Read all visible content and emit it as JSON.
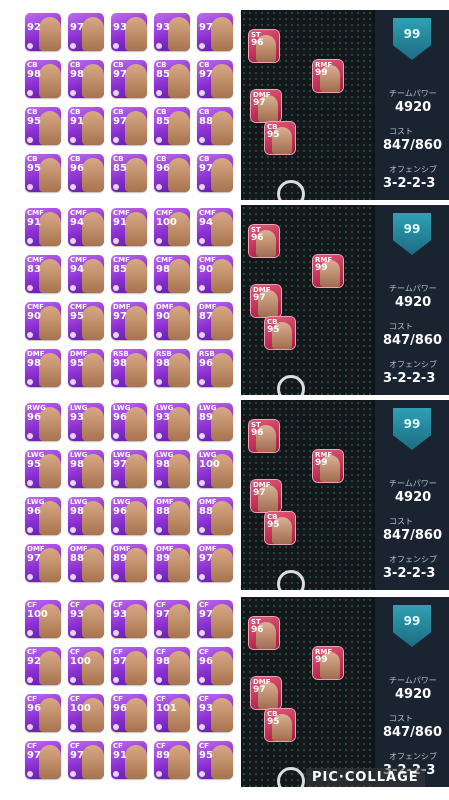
{
  "panels": [
    {
      "cards": [
        [
          {
            "pos": "",
            "ovr": "92"
          },
          {
            "pos": "",
            "ovr": "97"
          },
          {
            "pos": "",
            "ovr": "93"
          },
          {
            "pos": "",
            "ovr": "93"
          },
          {
            "pos": "",
            "ovr": "97"
          }
        ],
        [
          {
            "pos": "CB",
            "ovr": "98"
          },
          {
            "pos": "CB",
            "ovr": "98"
          },
          {
            "pos": "CB",
            "ovr": "97"
          },
          {
            "pos": "CB",
            "ovr": "85"
          },
          {
            "pos": "CB",
            "ovr": "97"
          }
        ],
        [
          {
            "pos": "CB",
            "ovr": "95"
          },
          {
            "pos": "CB",
            "ovr": "91"
          },
          {
            "pos": "CB",
            "ovr": "97"
          },
          {
            "pos": "CB",
            "ovr": "85"
          },
          {
            "pos": "CB",
            "ovr": "88"
          }
        ],
        [
          {
            "pos": "CB",
            "ovr": "95"
          },
          {
            "pos": "CB",
            "ovr": "96"
          },
          {
            "pos": "CB",
            "ovr": "85"
          },
          {
            "pos": "CB",
            "ovr": "96"
          },
          {
            "pos": "CB",
            "ovr": "97"
          }
        ]
      ],
      "pitch": [
        {
          "pos": "ST",
          "ovr": "96"
        },
        {
          "pos": "RMF",
          "ovr": "99"
        },
        {
          "pos": "DMF",
          "ovr": "97"
        },
        {
          "pos": "CB",
          "ovr": "95"
        }
      ],
      "stats": {
        "rating": "99",
        "power_label": "チームパワー",
        "power": "4920",
        "cost_label": "コスト",
        "cost": "847/860",
        "offense_label": "オフェンシブ",
        "formation": "3-2-2-3"
      }
    },
    {
      "cards": [
        [
          {
            "pos": "CMF",
            "ovr": "91"
          },
          {
            "pos": "CMF",
            "ovr": "94"
          },
          {
            "pos": "CMF",
            "ovr": "91"
          },
          {
            "pos": "CMF",
            "ovr": "100"
          },
          {
            "pos": "CMF",
            "ovr": "94"
          }
        ],
        [
          {
            "pos": "CMF",
            "ovr": "83"
          },
          {
            "pos": "CMF",
            "ovr": "94"
          },
          {
            "pos": "CMF",
            "ovr": "85"
          },
          {
            "pos": "CMF",
            "ovr": "98"
          },
          {
            "pos": "CMF",
            "ovr": "90"
          }
        ],
        [
          {
            "pos": "CMF",
            "ovr": "90"
          },
          {
            "pos": "CMF",
            "ovr": "95"
          },
          {
            "pos": "DMF",
            "ovr": "97"
          },
          {
            "pos": "DMF",
            "ovr": "90"
          },
          {
            "pos": "DMF",
            "ovr": "87"
          }
        ],
        [
          {
            "pos": "DMF",
            "ovr": "98"
          },
          {
            "pos": "DMF",
            "ovr": "95"
          },
          {
            "pos": "RSB",
            "ovr": "98"
          },
          {
            "pos": "RSB",
            "ovr": "98"
          },
          {
            "pos": "RSB",
            "ovr": "96"
          }
        ]
      ],
      "pitch": [
        {
          "pos": "ST",
          "ovr": "96"
        },
        {
          "pos": "RMF",
          "ovr": "99"
        },
        {
          "pos": "DMF",
          "ovr": "97"
        },
        {
          "pos": "CB",
          "ovr": "95"
        }
      ],
      "stats": {
        "rating": "99",
        "power_label": "チームパワー",
        "power": "4920",
        "cost_label": "コスト",
        "cost": "847/860",
        "offense_label": "オフェンシブ",
        "formation": "3-2-2-3"
      }
    },
    {
      "cards": [
        [
          {
            "pos": "RWG",
            "ovr": "96"
          },
          {
            "pos": "LWG",
            "ovr": "93"
          },
          {
            "pos": "LWG",
            "ovr": "96"
          },
          {
            "pos": "LWG",
            "ovr": "93"
          },
          {
            "pos": "LWG",
            "ovr": "89"
          }
        ],
        [
          {
            "pos": "LWG",
            "ovr": "95"
          },
          {
            "pos": "LWG",
            "ovr": "98"
          },
          {
            "pos": "LWG",
            "ovr": "97"
          },
          {
            "pos": "LWG",
            "ovr": "98"
          },
          {
            "pos": "LWG",
            "ovr": "100"
          }
        ],
        [
          {
            "pos": "LWG",
            "ovr": "96"
          },
          {
            "pos": "LWG",
            "ovr": "98"
          },
          {
            "pos": "LWG",
            "ovr": "96"
          },
          {
            "pos": "OMF",
            "ovr": "88"
          },
          {
            "pos": "OMF",
            "ovr": "88"
          }
        ],
        [
          {
            "pos": "OMF",
            "ovr": "97"
          },
          {
            "pos": "OMF",
            "ovr": "88"
          },
          {
            "pos": "OMF",
            "ovr": "89"
          },
          {
            "pos": "OMF",
            "ovr": "89"
          },
          {
            "pos": "OMF",
            "ovr": "97"
          }
        ]
      ],
      "pitch": [
        {
          "pos": "ST",
          "ovr": "96"
        },
        {
          "pos": "RMF",
          "ovr": "99"
        },
        {
          "pos": "DMF",
          "ovr": "97"
        },
        {
          "pos": "CB",
          "ovr": "95"
        }
      ],
      "stats": {
        "rating": "99",
        "power_label": "チームパワー",
        "power": "4920",
        "cost_label": "コスト",
        "cost": "847/860",
        "offense_label": "オフェンシブ",
        "formation": "3-2-2-3"
      }
    },
    {
      "cards": [
        [
          {
            "pos": "CF",
            "ovr": "100"
          },
          {
            "pos": "CF",
            "ovr": "93"
          },
          {
            "pos": "CF",
            "ovr": "93"
          },
          {
            "pos": "CF",
            "ovr": "97"
          },
          {
            "pos": "CF",
            "ovr": "97"
          }
        ],
        [
          {
            "pos": "CF",
            "ovr": "92"
          },
          {
            "pos": "CF",
            "ovr": "100"
          },
          {
            "pos": "CF",
            "ovr": "97"
          },
          {
            "pos": "CF",
            "ovr": "98"
          },
          {
            "pos": "CF",
            "ovr": "96"
          }
        ],
        [
          {
            "pos": "CF",
            "ovr": "96"
          },
          {
            "pos": "CF",
            "ovr": "100"
          },
          {
            "pos": "CF",
            "ovr": "96"
          },
          {
            "pos": "CF",
            "ovr": "101"
          },
          {
            "pos": "CF",
            "ovr": "93"
          }
        ],
        [
          {
            "pos": "CF",
            "ovr": "97"
          },
          {
            "pos": "CF",
            "ovr": "97"
          },
          {
            "pos": "CF",
            "ovr": "91"
          },
          {
            "pos": "CF",
            "ovr": "89"
          },
          {
            "pos": "CF",
            "ovr": "95"
          }
        ]
      ],
      "pitch": [
        {
          "pos": "ST",
          "ovr": "96"
        },
        {
          "pos": "RMF",
          "ovr": "99"
        },
        {
          "pos": "DMF",
          "ovr": "97"
        },
        {
          "pos": "CB",
          "ovr": "95"
        }
      ],
      "stats": {
        "rating": "99",
        "power_label": "チームパワー",
        "power": "4920",
        "cost_label": "コスト",
        "cost": "847/860",
        "offense_label": "オフェンシブ",
        "formation": "3-2-2-3"
      }
    }
  ],
  "watermark": "PIC·COLLAGE"
}
